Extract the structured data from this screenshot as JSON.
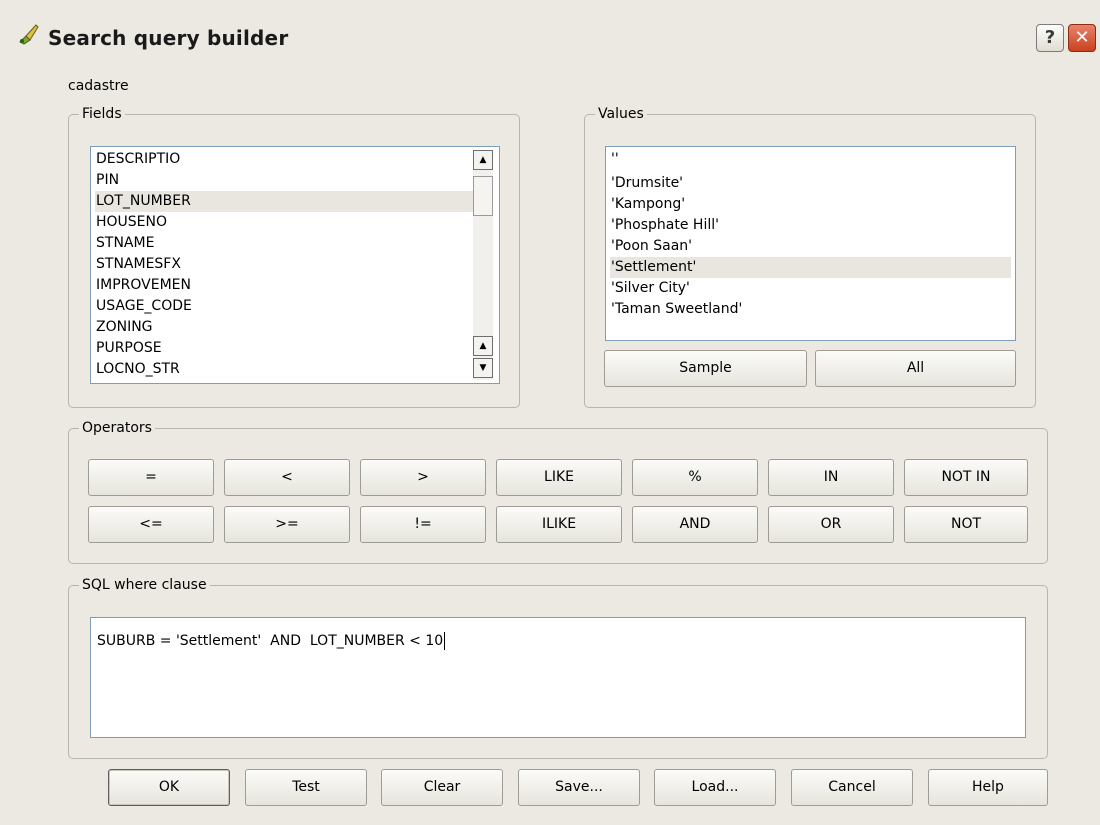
{
  "window": {
    "title": "Search query builder"
  },
  "layer_name": "cadastre",
  "fields": {
    "legend": "Fields",
    "items": [
      "DESCRIPTIO",
      "PIN",
      "LOT_NUMBER",
      "HOUSENO",
      "STNAME",
      "STNAMESFX",
      "IMPROVEMEN",
      "USAGE_CODE",
      "ZONING",
      "PURPOSE",
      "LOCNO_STR"
    ],
    "selected": "LOT_NUMBER"
  },
  "values": {
    "legend": "Values",
    "items": [
      "''",
      "'Drumsite'",
      "'Kampong'",
      "'Phosphate Hill'",
      "'Poon Saan'",
      "'Settlement'",
      "'Silver City'",
      "'Taman Sweetland'"
    ],
    "selected": "'Settlement'",
    "sample_label": "Sample",
    "all_label": "All"
  },
  "operators": {
    "legend": "Operators",
    "row1": [
      "=",
      "<",
      ">",
      "LIKE",
      "%",
      "IN",
      "NOT IN"
    ],
    "row2": [
      "<=",
      ">=",
      "!=",
      "ILIKE",
      "AND",
      "OR",
      "NOT"
    ]
  },
  "sql": {
    "legend": "SQL where clause",
    "text": "SUBURB = 'Settlement'  AND  LOT_NUMBER < 10"
  },
  "buttons": {
    "ok": "OK",
    "test": "Test",
    "clear": "Clear",
    "save": "Save...",
    "load": "Load...",
    "cancel": "Cancel",
    "help": "Help"
  },
  "icons": {
    "title": "pencil-brush-icon",
    "help": "question-icon",
    "close": "close-icon",
    "scroll_up": "up-arrow-icon",
    "scroll_down": "down-arrow-icon"
  }
}
